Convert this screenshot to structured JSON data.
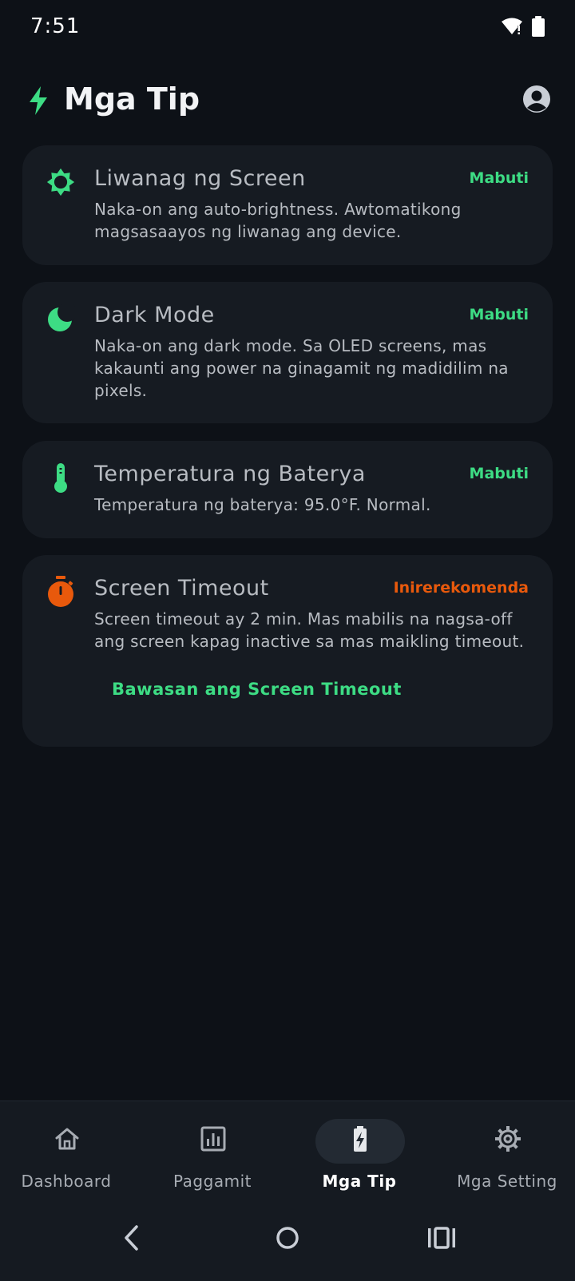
{
  "status_bar": {
    "time": "7:51"
  },
  "header": {
    "title": "Mga Tip"
  },
  "colors": {
    "good": "#3ddc84",
    "warn": "#e8590c",
    "background": "#0d1117",
    "card": "#161b22"
  },
  "tips": [
    {
      "icon": "brightness-icon",
      "title": "Liwanag ng Screen",
      "badge": "Mabuti",
      "description": "Naka-on ang auto-brightness. Awtomatikong magsasaayos ng liwanag ang device."
    },
    {
      "icon": "moon-icon",
      "title": "Dark Mode",
      "badge": "Mabuti",
      "description": "Naka-on ang dark mode. Sa OLED screens, mas kakaunti ang power na ginagamit ng madidilim na pixels."
    },
    {
      "icon": "thermometer-icon",
      "title": "Temperatura ng Baterya",
      "badge": "Mabuti",
      "description": "Temperatura ng baterya: 95.0°F. Normal."
    },
    {
      "icon": "timer-icon",
      "title": "Screen Timeout",
      "badge": "Inirerekomenda",
      "description": "Screen timeout ay 2 min. Mas mabilis na nagsa-off ang screen kapag inactive sa mas maikling timeout.",
      "action": "Bawasan ang Screen Timeout"
    }
  ],
  "bottom_nav": [
    {
      "label": "Dashboard",
      "icon": "home-icon",
      "active": false
    },
    {
      "label": "Paggamit",
      "icon": "bar-chart-icon",
      "active": false
    },
    {
      "label": "Mga Tip",
      "icon": "battery-bolt-icon",
      "active": true
    },
    {
      "label": "Mga Setting",
      "icon": "gear-icon",
      "active": false
    }
  ]
}
